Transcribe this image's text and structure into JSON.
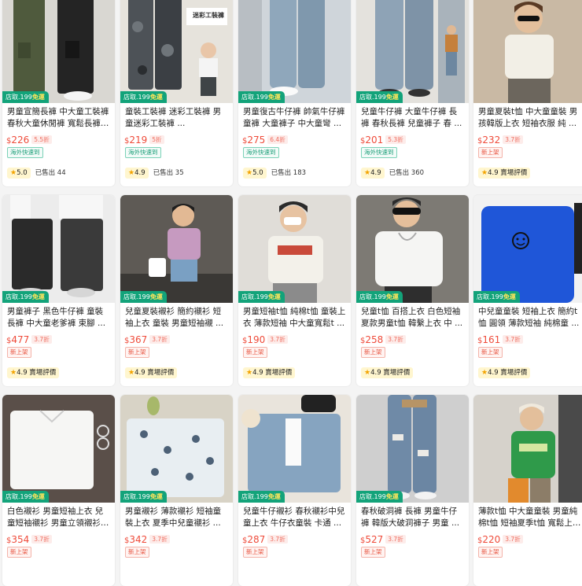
{
  "products": [
    {
      "title": "男童宣簡長褲 中大童工裝褲 春秋大童休閒褲 寬鬆長褲 男童長褲 ...",
      "price": "226",
      "discount": "5.5折",
      "tag": "海外快速到",
      "tag_color": "green",
      "rating": "5.0",
      "rating_text": "",
      "sold": "已售出 44",
      "badge_prefix": "店取",
      "badge_price": ".199",
      "badge_ship": "免運",
      "image": "cargo-pants-olive-black"
    },
    {
      "title": "童裝工裝褲 迷彩工裝褲 男童迷彩工裝褲 ...",
      "price": "219",
      "discount": "5折",
      "tag": "海外快速到",
      "tag_color": "green",
      "rating": "4.9",
      "rating_text": "",
      "sold": "已售出 35",
      "badge_prefix": "店取",
      "badge_price": ".199",
      "badge_ship": "免運",
      "image": "camo-cargo-pants"
    },
    {
      "title": "男童復古牛仔褲 帥氣牛仔褲 童褲 大童褲子 中大童彎 ...",
      "price": "275",
      "discount": "6.4折",
      "tag": "海外快速到",
      "tag_color": "green",
      "rating": "5.0",
      "rating_text": "",
      "sold": "已售出 183",
      "badge_prefix": "店取",
      "badge_price": ".199",
      "badge_ship": "免運",
      "image": "light-wash-jeans"
    },
    {
      "title": "兒童牛仔褲 大童牛仔褲 長褲 春秋長褲 兒童褲子 春 ...",
      "price": "201",
      "discount": "5.3折",
      "tag": "海外快速到",
      "tag_color": "green",
      "rating": "4.9",
      "rating_text": "",
      "sold": "已售出 360",
      "badge_prefix": "店取",
      "badge_price": ".199",
      "badge_ship": "免運",
      "image": "wide-leg-jeans"
    },
    {
      "title": "男童夏裝t恤 中大童童裝 男孩韓版上衣 短袖衣服 純 ...",
      "price": "232",
      "discount": "3.7折",
      "tag": "新上架",
      "tag_color": "red",
      "rating": "4.9",
      "rating_text": "賣場評價",
      "sold": "",
      "badge_prefix": "",
      "badge_price": "",
      "badge_ship": "",
      "image": "boy-white-tee-sunglasses"
    },
    {
      "title": "男童褲子 黑色牛仔褲 童裝長褲 中大童老爹褲 束腳 ...",
      "price": "477",
      "discount": "3.7折",
      "tag": "新上架",
      "tag_color": "red",
      "rating": "4.9",
      "rating_text": "賣場評價",
      "sold": "",
      "badge_prefix": "店取",
      "badge_price": ".199",
      "badge_ship": "免運",
      "image": "black-jeans-pair"
    },
    {
      "title": "兒童夏裝襯衫 簡約襯衫 短袖上衣 童裝 男童短袖襯 ...",
      "price": "367",
      "discount": "3.7折",
      "tag": "新上架",
      "tag_color": "red",
      "rating": "4.9",
      "rating_text": "賣場評價",
      "sold": "",
      "badge_prefix": "店取",
      "badge_price": ".199",
      "badge_ship": "免運",
      "image": "pink-shirt-denim-shorts"
    },
    {
      "title": "男童短袖t恤 純棉t恤 童裝上衣 薄款短袖 中大童寬鬆t ...",
      "price": "190",
      "discount": "3.7折",
      "tag": "新上架",
      "tag_color": "red",
      "rating": "4.9",
      "rating_text": "賣場評價",
      "sold": "",
      "badge_prefix": "店取",
      "badge_price": ".199",
      "badge_ship": "免運",
      "image": "boy-printed-tee"
    },
    {
      "title": "兒童t恤 百搭上衣 白色短袖 夏款男童t恤 韓繫上衣 中 ...",
      "price": "258",
      "discount": "3.7折",
      "tag": "新上架",
      "tag_color": "red",
      "rating": "4.9",
      "rating_text": "賣場評價",
      "sold": "",
      "badge_prefix": "店取",
      "badge_price": ".199",
      "badge_ship": "免運",
      "image": "boy-white-tee-chain"
    },
    {
      "title": "中兒童童裝 短袖上衣 簡約t恤 圓領 薄款短袖 純棉童 ...",
      "price": "161",
      "discount": "3.7折",
      "tag": "新上架",
      "tag_color": "red",
      "rating": "4.9",
      "rating_text": "賣場評價",
      "sold": "",
      "badge_prefix": "店取",
      "badge_price": ".199",
      "badge_ship": "免運",
      "image": "blue-smiley-tee"
    },
    {
      "title": "白色襯衫 男童短袖上衣 兒童短袖襯衫 男童立領襯衫 ...",
      "price": "354",
      "discount": "3.7折",
      "tag": "新上架",
      "tag_color": "red",
      "rating": "",
      "rating_text": "",
      "sold": "",
      "badge_prefix": "店取",
      "badge_price": ".199",
      "badge_ship": "免運",
      "image": "white-shirt-flatlay"
    },
    {
      "title": "男童襯衫 薄款襯衫 短袖童裝上衣 夏季中兒童襯衫 ...",
      "price": "342",
      "discount": "3.7折",
      "tag": "新上架",
      "tag_color": "red",
      "rating": "",
      "rating_text": "",
      "sold": "",
      "badge_prefix": "店取",
      "badge_price": ".199",
      "badge_ship": "免運",
      "image": "print-shirt-flatlay"
    },
    {
      "title": "兒童牛仔襯衫 春秋襯衫中兒童上衣 牛仔衣童裝 卡通 ...",
      "price": "287",
      "discount": "3.7折",
      "tag": "新上架",
      "tag_color": "red",
      "rating": "",
      "rating_text": "",
      "sold": "",
      "badge_prefix": "店取",
      "badge_price": ".199",
      "badge_ship": "免運",
      "image": "denim-shirt-flatlay"
    },
    {
      "title": "春秋破洞褲 長褲 男童牛仔褲 韓版大破洞褲子 男童 ...",
      "price": "527",
      "discount": "3.7折",
      "tag": "新上架",
      "tag_color": "red",
      "rating": "",
      "rating_text": "",
      "sold": "",
      "badge_prefix": "店取",
      "badge_price": ".199",
      "badge_ship": "免運",
      "image": "ripped-jeans"
    },
    {
      "title": "薄款t恤 中大童童裝 男童純棉t恤 短袖夏季t恤 寬鬆上 ...",
      "price": "220",
      "discount": "3.7折",
      "tag": "新上架",
      "tag_color": "red",
      "rating": "",
      "rating_text": "",
      "sold": "",
      "badge_prefix": "",
      "badge_price": "",
      "badge_ship": "",
      "image": "boy-green-tee"
    }
  ],
  "currency": "$",
  "image_overlay_text": {
    "camo-cargo-pants": "迷彩工裝褲"
  }
}
